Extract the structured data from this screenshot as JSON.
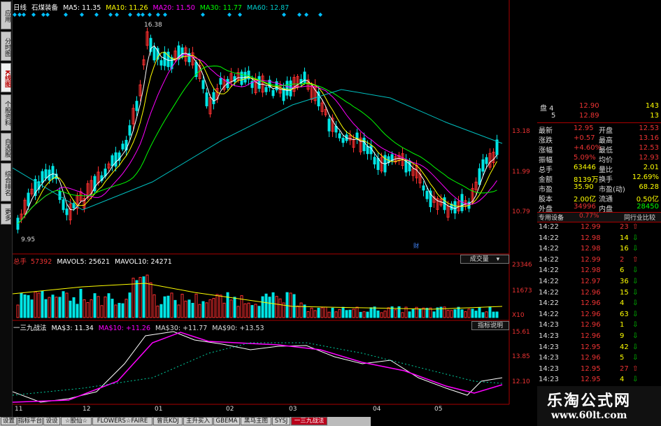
{
  "left_tabs": [
    {
      "label": "应用"
    },
    {
      "label": "分时图"
    },
    {
      "label": "K线图",
      "active": true
    },
    {
      "label": "个股资料"
    },
    {
      "label": "自选股"
    },
    {
      "label": "综合排名"
    },
    {
      "label": "更多"
    }
  ],
  "header": {
    "period": "日线",
    "stock": "石煤装备",
    "ma5": "MA5: 11.35",
    "ma10": "MA10: 11.26",
    "ma20": "MA20: 11.50",
    "ma30": "MA30: 11.77",
    "ma60": "MA60: 12.87"
  },
  "price_panel": {
    "high_label": "16.38",
    "low_label": "9.95",
    "y_ticks": [
      "13.18",
      "11.99",
      "10.79"
    ],
    "marker": "财"
  },
  "volume_panel": {
    "total": "总手",
    "total_val": "57392",
    "mavol5": "MAVOL5: 25621",
    "mavol10": "MAVOL10: 24271",
    "dropdown": "成交量",
    "y_ticks": [
      "23346",
      "11673",
      "X10"
    ]
  },
  "indicator_panel": {
    "name": "一三九战法",
    "ma3": "MA$3: 11.34",
    "ma10": "MA$10: +11.26",
    "ma30": "MA$30: +11.77",
    "ma90": "MA$90: +13.53",
    "button": "指标说明",
    "y_ticks": [
      "15.61",
      "13.85",
      "12.10"
    ]
  },
  "x_axis": [
    "11",
    "12",
    "01",
    "02",
    "03",
    "04",
    "05"
  ],
  "quote": {
    "order_rows": [
      {
        "label": "盘 4",
        "price": "12.90",
        "vol": "143"
      },
      {
        "label": "5",
        "price": "12.89",
        "vol": "13"
      }
    ],
    "stats": [
      {
        "l1": "最新",
        "v1": "12.95",
        "l2": "开盘",
        "v2": "12.53"
      },
      {
        "l1": "涨跌",
        "v1": "+0.57",
        "l2": "最高",
        "v2": "13.16"
      },
      {
        "l1": "涨幅",
        "v1": "+4.60%",
        "l2": "最低",
        "v2": "12.53"
      },
      {
        "l1": "振幅",
        "v1": "5.09%",
        "l2": "均价",
        "v2": "12.93"
      },
      {
        "l1": "总手",
        "v1": "63446",
        "l2": "量比",
        "v2": "2.01"
      },
      {
        "l1": "金额",
        "v1": "8139万",
        "l2": "换手",
        "v2": "12.69%"
      },
      {
        "l1": "市盈",
        "v1": "35.90",
        "l2": "市盈(动)",
        "v2": "68.28"
      },
      {
        "l1": "股本",
        "v1": "2.00亿",
        "l2": "流通",
        "v2": "0.50亿"
      },
      {
        "l1": "外盘",
        "v1": "34996",
        "l2": "内盘",
        "v2": "28450"
      }
    ],
    "industry": "专用设备",
    "industry_pct": "0.77%",
    "compare": "同行业比较",
    "trades": [
      {
        "t": "14:22",
        "p": "12.99",
        "v": "23",
        "d": "up"
      },
      {
        "t": "14:22",
        "p": "12.98",
        "v": "14",
        "d": "down"
      },
      {
        "t": "14:22",
        "p": "12.98",
        "v": "16",
        "d": "down"
      },
      {
        "t": "14:22",
        "p": "12.99",
        "v": "2",
        "d": "up"
      },
      {
        "t": "14:22",
        "p": "12.98",
        "v": "6",
        "d": "down"
      },
      {
        "t": "14:22",
        "p": "12.97",
        "v": "36",
        "d": "down"
      },
      {
        "t": "14:22",
        "p": "12.96",
        "v": "15",
        "d": "down"
      },
      {
        "t": "14:22",
        "p": "12.96",
        "v": "4",
        "d": "down"
      },
      {
        "t": "14:22",
        "p": "12.96",
        "v": "63",
        "d": "down"
      },
      {
        "t": "14:23",
        "p": "12.96",
        "v": "1",
        "d": "down"
      },
      {
        "t": "14:23",
        "p": "12.96",
        "v": "9",
        "d": "down"
      },
      {
        "t": "14:23",
        "p": "12.95",
        "v": "42",
        "d": "down"
      },
      {
        "t": "14:23",
        "p": "12.96",
        "v": "5",
        "d": "down"
      },
      {
        "t": "14:23",
        "p": "12.95",
        "v": "27",
        "d": "up"
      },
      {
        "t": "14:23",
        "p": "12.95",
        "v": "4",
        "d": "down"
      }
    ]
  },
  "bottom_tabs": [
    "设置",
    "指标平台",
    "设设",
    "☆股仙☆",
    "FLOWERS☆FAIRE",
    "曾氏KDJ",
    "主升买入",
    "GBEMA",
    "黑马主图",
    "SYSJ",
    "一三九战法"
  ],
  "watermark": {
    "cn": "乐淘公式网",
    "url": "www.60lt.com"
  },
  "colors": {
    "up": "#ff3030",
    "down": "#00e6e6",
    "white": "#ffffff",
    "yellow": "#ffff00",
    "magenta": "#ff00ff",
    "green": "#00ff00",
    "cyan_line": "#00bfbf"
  }
}
